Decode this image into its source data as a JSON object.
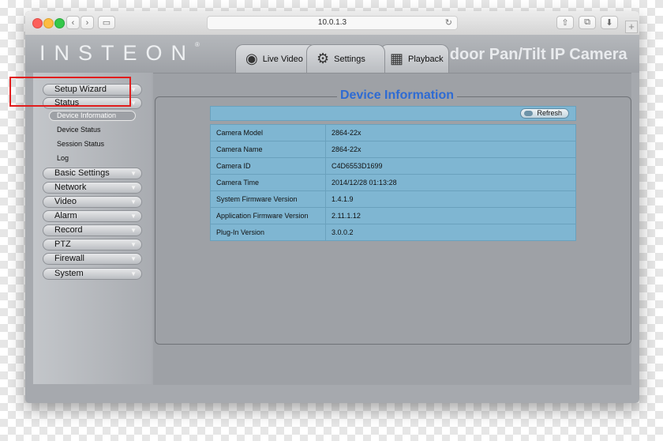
{
  "browser": {
    "address": "10.0.1.3",
    "back_glyph": "‹",
    "forward_glyph": "›",
    "sidebar_glyph": "▭",
    "reload_glyph": "↻",
    "share_glyph": "⇧",
    "tabs_glyph": "⧉",
    "download_glyph": "⬇",
    "new_tab_glyph": "+"
  },
  "header": {
    "logo": "INSTEON",
    "logo_mark": "®",
    "product_title": "Indoor Pan/Tilt IP Camera",
    "tabs": [
      {
        "label": "Live Video",
        "icon": "webcam-icon",
        "glyph": "◉"
      },
      {
        "label": "Settings",
        "icon": "settings-icon",
        "glyph": "⚙"
      },
      {
        "label": "Playback",
        "icon": "calendar-icon",
        "glyph": "▦"
      }
    ]
  },
  "sidebar": {
    "chevron": "▼",
    "items": [
      {
        "label": "Setup Wizard"
      },
      {
        "label": "Status"
      },
      {
        "label": "Basic Settings"
      },
      {
        "label": "Network"
      },
      {
        "label": "Video"
      },
      {
        "label": "Alarm"
      },
      {
        "label": "Record"
      },
      {
        "label": "PTZ"
      },
      {
        "label": "Firewall"
      },
      {
        "label": "System"
      }
    ],
    "status_sub": [
      {
        "label": "Device Information",
        "active": true
      },
      {
        "label": "Device Status"
      },
      {
        "label": "Session Status"
      },
      {
        "label": "Log"
      }
    ]
  },
  "main": {
    "title": "Device Information",
    "refresh_label": "Refresh",
    "rows": [
      {
        "key": "Camera Model",
        "value": "2864-22x"
      },
      {
        "key": "Camera Name",
        "value": "2864-22x"
      },
      {
        "key": "Camera ID",
        "value": "C4D6553D1699"
      },
      {
        "key": "Camera Time",
        "value": "2014/12/28 01:13:28"
      },
      {
        "key": "System Firmware Version",
        "value": "1.4.1.9"
      },
      {
        "key": "Application Firmware Version",
        "value": "2.11.1.12"
      },
      {
        "key": "Plug-In Version",
        "value": "3.0.0.2"
      }
    ]
  },
  "colors": {
    "highlight": "#e11d1d",
    "title_blue": "#2e6bd3",
    "table_blue": "#7fb6d2"
  }
}
